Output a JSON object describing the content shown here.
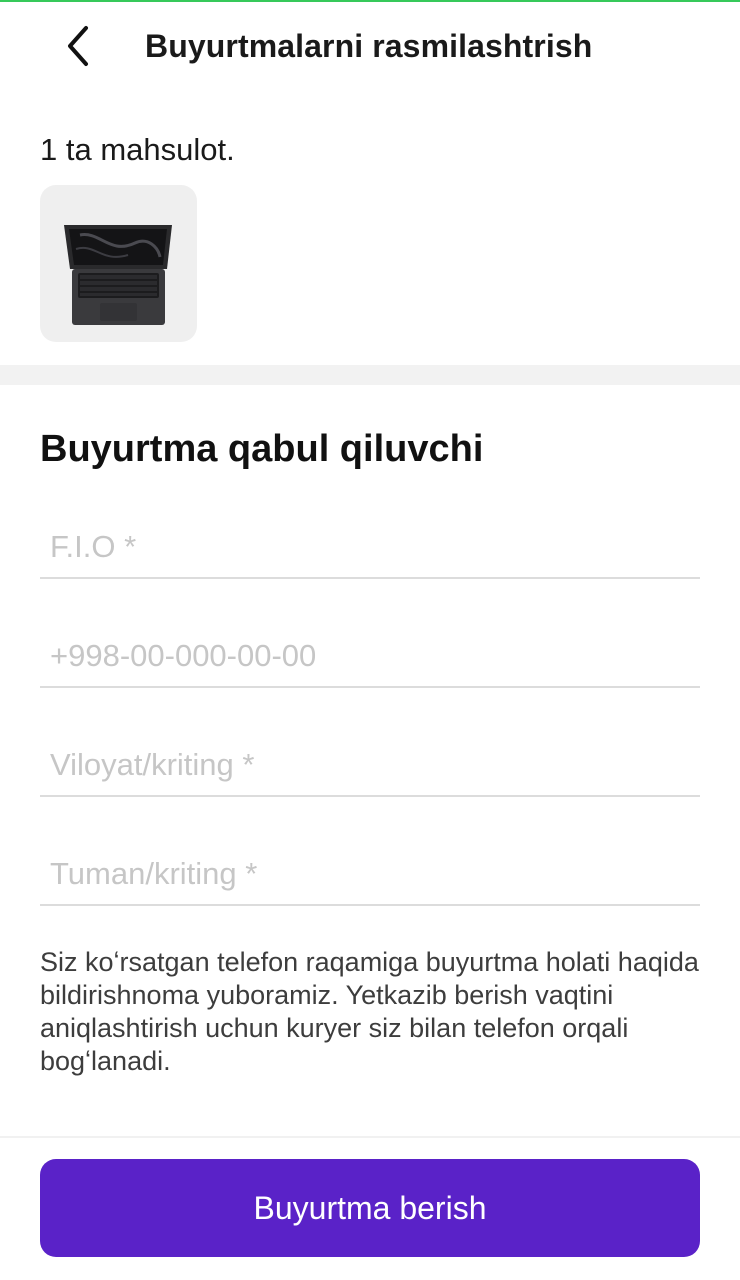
{
  "header": {
    "title": "Buyurtmalarni rasmilashtrish",
    "back_icon": "chevron-left-icon"
  },
  "cart": {
    "count_label": "1 ta mahsulot.",
    "items": [
      {
        "image": "laptop-product-image"
      }
    ]
  },
  "recipient": {
    "section_title": "Buyurtma qabul qiluvchi",
    "fields": {
      "full_name": {
        "placeholder": "F.I.O *",
        "value": ""
      },
      "phone": {
        "placeholder": "+998-00-000-00-00",
        "value": ""
      },
      "region": {
        "placeholder": "Viloyat/kriting *",
        "value": ""
      },
      "district": {
        "placeholder": "Tuman/kriting *",
        "value": ""
      }
    }
  },
  "note": "Siz koʻrsatgan telefon raqamiga buyurtma holati haqida bildirishnoma yuboramiz. Yetkazib berish vaqtini aniqlashtirish uchun kuryer siz bilan telefon orqali bogʻlanadi.",
  "cta": {
    "label": "Buyurtma berish"
  },
  "colors": {
    "accent": "#5a22c8",
    "top_line": "#36c95a",
    "placeholder": "#c6c6c6"
  }
}
